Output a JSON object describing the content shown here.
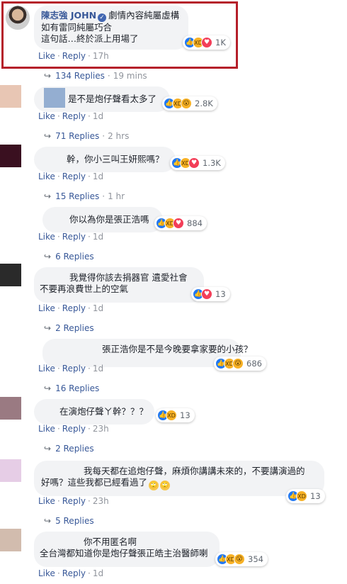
{
  "top_comment": {
    "author": "陳志強 JOHN",
    "author_note": "劇情內容純屬虛構",
    "lines": [
      "如有雷同純屬巧合",
      "這句話…終於派上用場了"
    ],
    "reaction_count": "1K",
    "like": "Like",
    "reply": "Reply",
    "time": "17h",
    "replies": "134 Replies",
    "replies_time": "19 mins"
  },
  "comments": [
    {
      "lines": [
        "是不是炮仔聲看太多了"
      ],
      "reaction_count": "2.8K",
      "like": "Like",
      "reply": "Reply",
      "time": "1d",
      "replies": "71 Replies",
      "replies_time": "2 hrs"
    },
    {
      "lines": [
        "幹，你小三叫王妍熙嗎？"
      ],
      "reaction_count": "1.3K",
      "like": "Like",
      "reply": "Reply",
      "time": "1d",
      "replies": "15 Replies",
      "replies_time": "1 hr"
    },
    {
      "lines": [
        "你以為你是張正浩嗎"
      ],
      "reaction_count": "884",
      "like": "Like",
      "reply": "Reply",
      "time": "1d",
      "replies": "6 Replies"
    },
    {
      "lines": [
        "我覺得你該去捐器官 遺愛社會",
        "不要再浪費世上的空氣"
      ],
      "reaction_count": "13",
      "like": "Like",
      "reply": "Reply",
      "time": "1d",
      "replies": "2 Replies"
    },
    {
      "lines": [
        "張正浩你是不是今晚要拿家要的小孩？"
      ],
      "reaction_count": "686",
      "like": "Like",
      "reply": "Reply",
      "time": "1d",
      "replies": "16 Replies"
    },
    {
      "lines": [
        "在演炮仔聲ㄚ幹？？？"
      ],
      "reaction_count": "13",
      "like": "Like",
      "reply": "Reply",
      "time": "23h",
      "replies": "2 Replies"
    },
    {
      "lines": [
        "我每天都在追炮仔聲，麻煩你講講未來的，不要講演過的",
        "好嗎？這些我都已經看過了"
      ],
      "reaction_count": "13",
      "like": "Like",
      "reply": "Reply",
      "time": "23h",
      "replies": "5 Replies"
    },
    {
      "lines": [
        "你不用匿名啊",
        "全台灣都知道你是炮仔聲張正皓主治醫師喇"
      ],
      "reaction_count": "354",
      "like": "Like",
      "reply": "Reply",
      "time": "1d"
    }
  ],
  "icons": {
    "like": "thumbs-up-icon",
    "haha": "laughing-face-icon",
    "love": "heart-icon",
    "wow": "surprised-face-icon",
    "reply_arrow": "reply-arrow-icon",
    "verified": "verified-badge-icon",
    "eyeroll": "eye-roll-emoji-icon"
  },
  "colors": {
    "link": "#385898",
    "bubble": "#f2f3f5",
    "highlight": "#b51f2a",
    "like": "#2078f4",
    "love": "#f33e58",
    "haha": "#f7b125"
  }
}
